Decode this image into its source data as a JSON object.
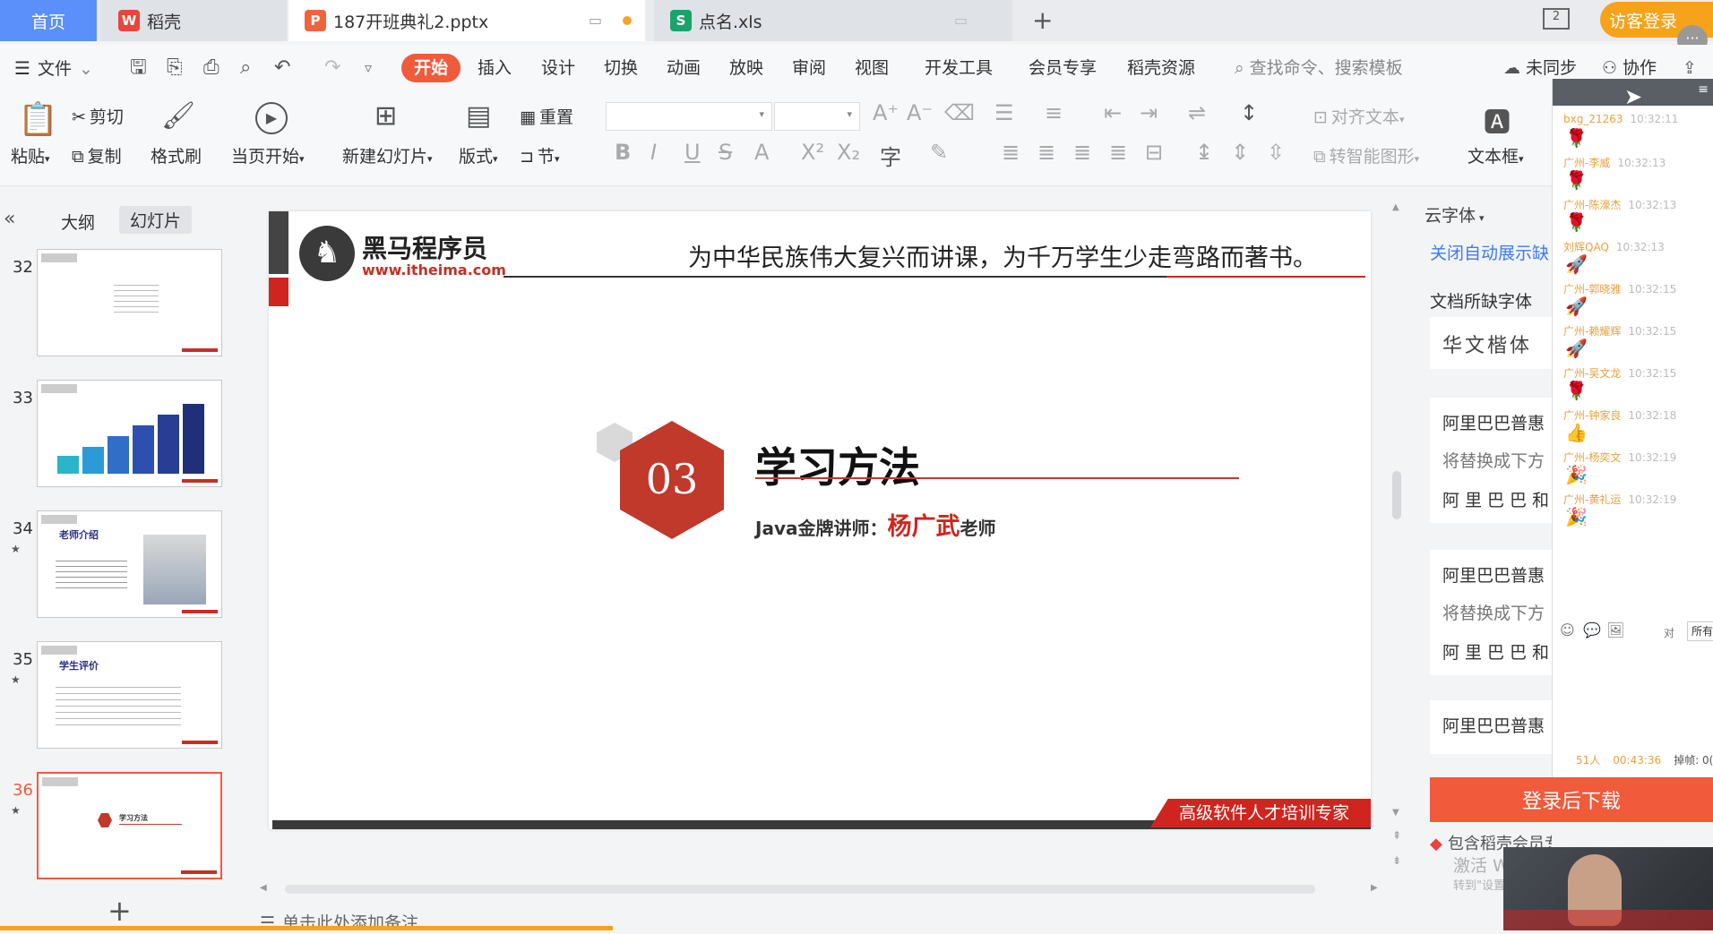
{
  "tabs": {
    "home": "首页",
    "daoke": "稻壳",
    "pptx": "187开班典礼2.pptx",
    "xls": "点名.xls",
    "visitor_login": "访客登录",
    "page_count_icon": "2"
  },
  "menu": {
    "file": "文件",
    "items": [
      "开始",
      "插入",
      "设计",
      "切换",
      "动画",
      "放映",
      "审阅",
      "视图",
      "开发工具",
      "会员专享",
      "稻壳资源"
    ],
    "search_placeholder": "查找命令、搜索模板",
    "unsynced": "未同步",
    "collab": "协作"
  },
  "ribbon": {
    "paste": "粘贴",
    "cut": "剪切",
    "copy": "复制",
    "format_painter": "格式刷",
    "from_current": "当页开始",
    "new_slide": "新建幻灯片",
    "layout": "版式",
    "reset": "重置",
    "section": "节",
    "align_text": "对齐文本",
    "smart_shape": "转智能图形",
    "textbox": "文本框"
  },
  "left_panel": {
    "outline_tab": "大纲",
    "slides_tab": "幻灯片",
    "slide_numbers": [
      "32",
      "33",
      "34",
      "35",
      "36"
    ],
    "thumb_34_title": "老师介绍",
    "thumb_35_title": "学生评价",
    "thumb_36_title": "学习方法",
    "add": "+"
  },
  "slide": {
    "logo_name": "黑马程序员",
    "logo_url": "www.itheima.com",
    "slogan": "为中华民族伟大复兴而讲课，为千万学生少走弯路而著书。",
    "section_number": "03",
    "section_title": "学习方法",
    "lecturer_prefix": "Java金牌讲师：",
    "lecturer_name": "杨广武",
    "lecturer_suffix": "老师",
    "footer_banner": "高级软件人才培训专家"
  },
  "notes_placeholder": "单击此处添加备注",
  "right_pane": {
    "cloud_font": "云字体",
    "close_auto": "关闭自动展示缺",
    "missing_fonts": "文档所缺字体",
    "font_huawen": "华文楷体",
    "font_alibaba_1": "阿里巴巴普惠",
    "replace_hint_1": "将替换成下方",
    "font_alibaba_preview_1": "阿里巴巴和",
    "font_alibaba_2": "阿里巴巴普惠",
    "replace_hint_2": "将替换成下方",
    "font_alibaba_preview_2": "阿里巴巴和",
    "font_alibaba_3": "阿里巴巴普惠",
    "download": "登录后下载",
    "member_hint": "包含稻壳会员专享字体",
    "win_activate_1": "激活 Windows",
    "win_activate_2": "转到\"设置\"以激活 Windows。"
  },
  "chat": {
    "messages": [
      {
        "name": "bxg_21263",
        "time": "10:32:11",
        "emoji": "🌹"
      },
      {
        "name": "广州-李威",
        "time": "10:32:13",
        "emoji": "🌹"
      },
      {
        "name": "广州-陈濠杰",
        "time": "10:32:13",
        "emoji": "🌹"
      },
      {
        "name": "刘辉QAQ",
        "time": "10:32:13",
        "emoji": "🚀"
      },
      {
        "name": "广州-郭晓雅",
        "time": "10:32:15",
        "emoji": "🚀"
      },
      {
        "name": "广州-赖耀辉",
        "time": "10:32:15",
        "emoji": "🚀"
      },
      {
        "name": "广州-吴文龙",
        "time": "10:32:15",
        "emoji": "🌹"
      },
      {
        "name": "广州-钟家良",
        "time": "10:32:18",
        "emoji": "👍"
      },
      {
        "name": "广州-杨奕文",
        "time": "10:32:19",
        "emoji": "🎉"
      },
      {
        "name": "广州-黄礼运",
        "time": "10:32:19",
        "emoji": "🎉"
      }
    ],
    "to_label": "对",
    "all_label": "所有",
    "people": "51人",
    "duration": "00:43:36",
    "mic_label": "掉帧: 0("
  }
}
